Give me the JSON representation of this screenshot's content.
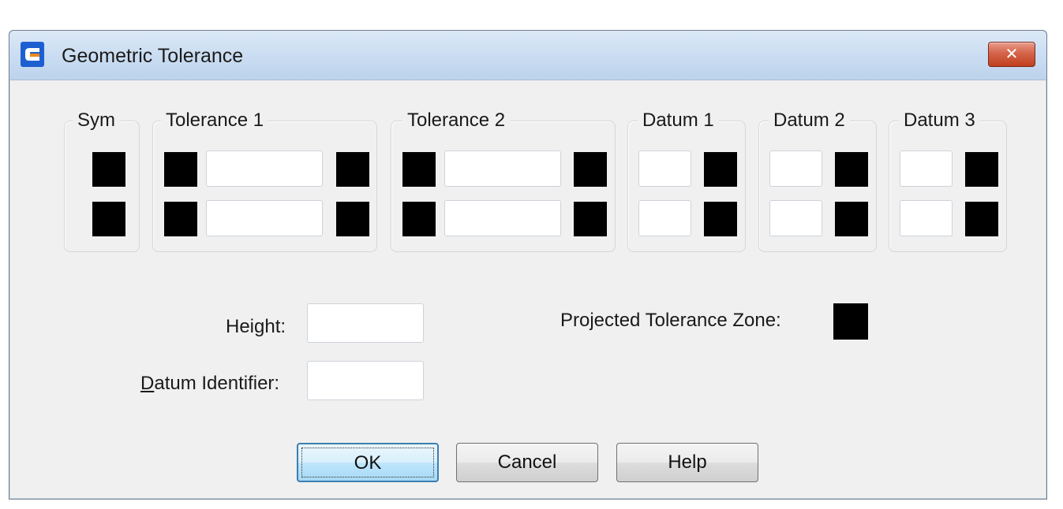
{
  "window": {
    "title": "Geometric Tolerance",
    "close_glyph": "✕",
    "app_icon": "app-logo-icon"
  },
  "groups": {
    "sym": "Sym",
    "tolerance1": "Tolerance 1",
    "tolerance2": "Tolerance 2",
    "datum1": "Datum 1",
    "datum2": "Datum 2",
    "datum3": "Datum 3"
  },
  "fields": {
    "height_label": "Height:",
    "datum_identifier_label_first": "D",
    "datum_identifier_label_rest": "atum Identifier:",
    "projected_zone_label": "Projected Tolerance Zone:"
  },
  "buttons": {
    "ok": "OK",
    "cancel": "Cancel",
    "help": "Help"
  },
  "colors": {
    "swatch": "#000000",
    "dialog_bg": "#f0f0f0",
    "title_bar": "#c9dcf1",
    "close_button": "#c0401f"
  }
}
